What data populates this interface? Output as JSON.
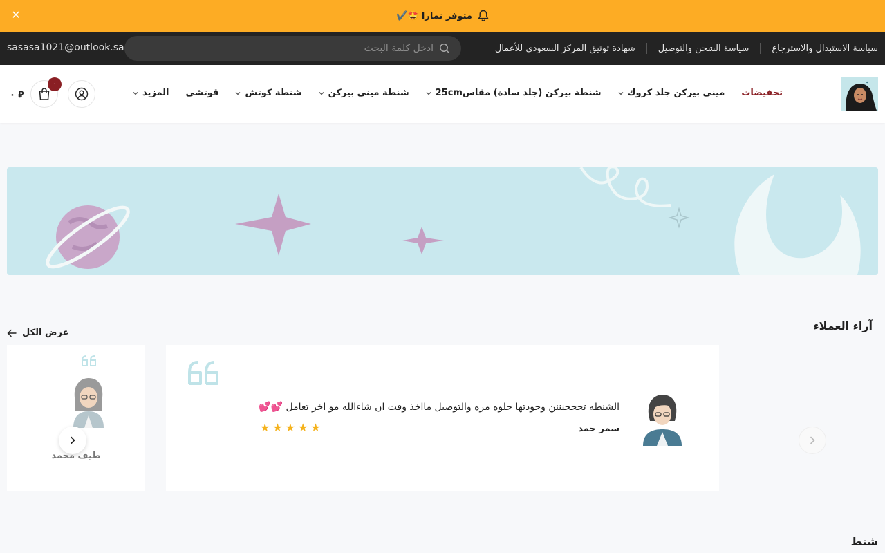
{
  "announcement": {
    "text": "متوفر نمارا 🤩✔️"
  },
  "topbar": {
    "email": "sasasa1021@outlook.sa",
    "search_placeholder": "ادخل كلمة البحث",
    "links": [
      "سياسة الاستبدال والاسترجاع",
      "سياسة الشحن والتوصيل",
      "شهادة توثيق المركز السعودي للأعمال"
    ]
  },
  "header": {
    "nav": [
      {
        "label": "تخفيضات",
        "dropdown": false,
        "sale": true
      },
      {
        "label": "ميني بيركن جلد كروك",
        "dropdown": true
      },
      {
        "label": "شنطة بيركن (جلد سادة) مقاس25cm",
        "dropdown": true
      },
      {
        "label": "شنطة ميني بيركن",
        "dropdown": true
      },
      {
        "label": "شنطة كوتش",
        "dropdown": true
      },
      {
        "label": "قوتشي",
        "dropdown": false
      },
      {
        "label": "المزيد",
        "dropdown": true
      }
    ],
    "cart_count": "٠",
    "cart_total": "٠ ⃁"
  },
  "reviews": {
    "title": "آراء العملاء",
    "view_all": "عرض الكل",
    "main": {
      "text": "الشنطه تجججنننن وجودتها حلوه مره والتوصيل مااخذ وقت ان شاءالله مو اخر تعامل 💕💕",
      "name": "سمر حمد",
      "rating": 5
    },
    "side": {
      "name": "طيف محمد"
    }
  },
  "next_section": {
    "title": "شنط"
  },
  "colors": {
    "announce_bg": "#fdac24",
    "topbar_bg": "#232323",
    "accent": "#8a1f24",
    "star": "#f5b21b",
    "banner_bg": "#c9e8ee"
  }
}
